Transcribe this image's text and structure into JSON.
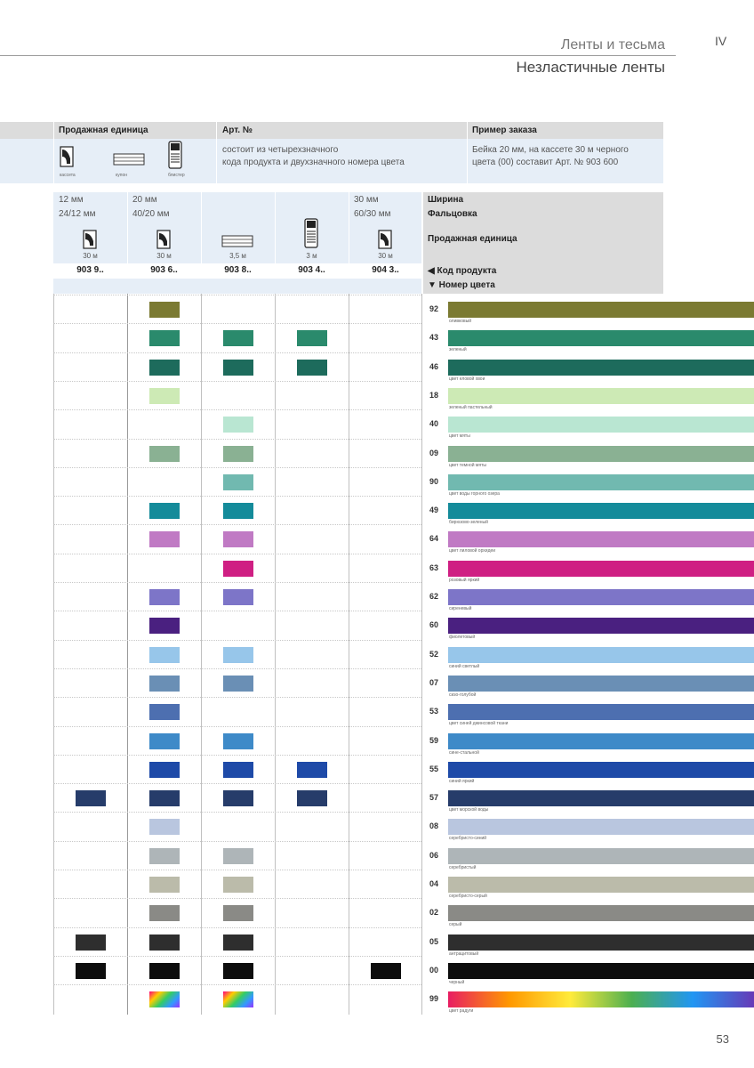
{
  "header": {
    "title": "Ленты и тесьма",
    "roman": "IV",
    "subtitle": "Незластичные ленты"
  },
  "info": {
    "col1_head": "Продажная единица",
    "col2_head": "Арт. №",
    "col3_head": "Пример заказа",
    "col2_text1": "состоит из четырехзначного",
    "col2_text2": "кода продукта и двухзначного номера цвета",
    "col3_text1": "Бейка 20 мм, на кассете 30 м черного",
    "col3_text2": "цвета (00) составит Арт. № 903 600",
    "units": [
      "кассета",
      "купон",
      "блистер"
    ]
  },
  "columns": [
    {
      "width": "12 мм",
      "fold": "24/12 мм",
      "unit": "30 м",
      "code": "903 9.."
    },
    {
      "width": "20 мм",
      "fold": "40/20 мм",
      "unit": "30 м",
      "code": "903 6.."
    },
    {
      "width": "",
      "fold": "",
      "unit": "3,5 м",
      "code": "903 8.."
    },
    {
      "width": "",
      "fold": "",
      "unit": "3 м",
      "code": "903 4.."
    },
    {
      "width": "30 мм",
      "fold": "60/30 мм",
      "unit": "30 м",
      "code": "904 3.."
    }
  ],
  "legend": {
    "width": "Ширина",
    "fold": "Фальцовка",
    "unit": "Продажная единица",
    "code": "◀ Код продукта",
    "color": "▼ Номер цвета"
  },
  "colors": [
    {
      "num": "92",
      "name": "оливковый",
      "hex": "#7b7a32",
      "avail": [
        0,
        1,
        0,
        0,
        0
      ]
    },
    {
      "num": "43",
      "name": "зеленый",
      "hex": "#2a8a6c",
      "avail": [
        0,
        1,
        1,
        1,
        0
      ]
    },
    {
      "num": "46",
      "name": "цвет еловой хвои",
      "hex": "#1d6b5c",
      "avail": [
        0,
        1,
        1,
        1,
        0
      ]
    },
    {
      "num": "18",
      "name": "зеленый пастельный",
      "hex": "#cdeab5",
      "avail": [
        0,
        1,
        0,
        0,
        0
      ]
    },
    {
      "num": "40",
      "name": "цвет мяты",
      "hex": "#b9e6d2",
      "avail": [
        0,
        0,
        1,
        0,
        0
      ]
    },
    {
      "num": "09",
      "name": "цвет темной мяты",
      "hex": "#8ab193",
      "avail": [
        0,
        1,
        1,
        0,
        0
      ]
    },
    {
      "num": "90",
      "name": "цвет воды горного озера",
      "hex": "#71b9b0",
      "avail": [
        0,
        0,
        1,
        0,
        0
      ]
    },
    {
      "num": "49",
      "name": "бирюзово-зеленый",
      "hex": "#148b9a",
      "avail": [
        0,
        1,
        1,
        0,
        0
      ]
    },
    {
      "num": "64",
      "name": "цвет лиловой орхидеи",
      "hex": "#c07ac4",
      "avail": [
        0,
        1,
        1,
        0,
        0
      ]
    },
    {
      "num": "63",
      "name": "розовый яркий",
      "hex": "#cf1f83",
      "avail": [
        0,
        0,
        1,
        0,
        0
      ]
    },
    {
      "num": "62",
      "name": "сиреневый",
      "hex": "#7d75c8",
      "avail": [
        0,
        1,
        1,
        0,
        0
      ]
    },
    {
      "num": "60",
      "name": "фиолетовый",
      "hex": "#4a2080",
      "avail": [
        0,
        1,
        0,
        0,
        0
      ]
    },
    {
      "num": "52",
      "name": "синий светлый",
      "hex": "#97c6ea",
      "avail": [
        0,
        1,
        1,
        0,
        0
      ]
    },
    {
      "num": "07",
      "name": "сизо-голубой",
      "hex": "#6a8fb5",
      "avail": [
        0,
        1,
        1,
        0,
        0
      ]
    },
    {
      "num": "53",
      "name": "цвет синей джинсовой ткани",
      "hex": "#4d6fb0",
      "avail": [
        0,
        1,
        0,
        0,
        0
      ]
    },
    {
      "num": "59",
      "name": "сине-стальной",
      "hex": "#3e8ac8",
      "avail": [
        0,
        1,
        1,
        0,
        0
      ]
    },
    {
      "num": "55",
      "name": "синий яркий",
      "hex": "#1e4aa8",
      "avail": [
        0,
        1,
        1,
        1,
        0
      ]
    },
    {
      "num": "57",
      "name": "цвет морской воды",
      "hex": "#263c6a",
      "avail": [
        1,
        1,
        1,
        1,
        0
      ]
    },
    {
      "num": "08",
      "name": "серебристо-синий",
      "hex": "#b9c6df",
      "avail": [
        0,
        1,
        0,
        0,
        0
      ]
    },
    {
      "num": "06",
      "name": "серебристый",
      "hex": "#aeb5b8",
      "avail": [
        0,
        1,
        1,
        0,
        0
      ]
    },
    {
      "num": "04",
      "name": "серебристо-серый",
      "hex": "#bbbbaa",
      "avail": [
        0,
        1,
        1,
        0,
        0
      ]
    },
    {
      "num": "02",
      "name": "серый",
      "hex": "#8a8a86",
      "avail": [
        0,
        1,
        1,
        0,
        0
      ]
    },
    {
      "num": "05",
      "name": "антрацитовый",
      "hex": "#2e2e2e",
      "avail": [
        1,
        1,
        1,
        0,
        0
      ]
    },
    {
      "num": "00",
      "name": "черный",
      "hex": "#0d0d0d",
      "avail": [
        1,
        1,
        1,
        0,
        1
      ]
    },
    {
      "num": "99",
      "name": "цвет радуги",
      "hex": "rainbow",
      "avail": [
        0,
        1,
        1,
        0,
        0
      ]
    }
  ],
  "page_number": "53"
}
